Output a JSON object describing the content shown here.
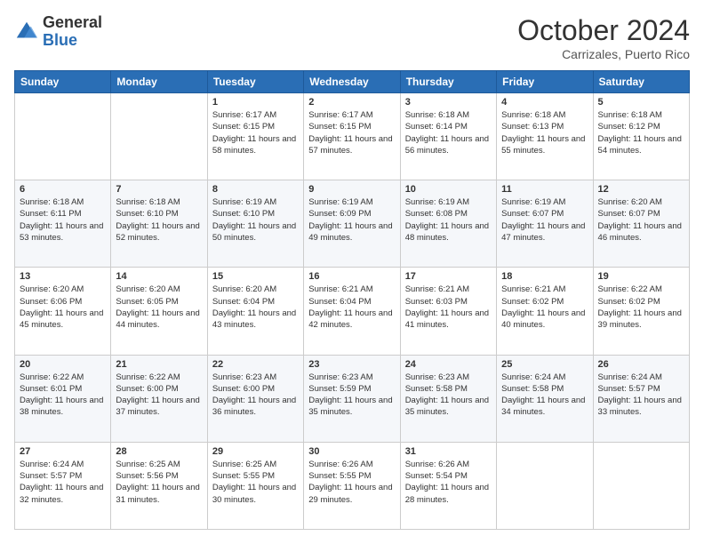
{
  "logo": {
    "general": "General",
    "blue": "Blue"
  },
  "header": {
    "title": "October 2024",
    "subtitle": "Carrizales, Puerto Rico"
  },
  "days_of_week": [
    "Sunday",
    "Monday",
    "Tuesday",
    "Wednesday",
    "Thursday",
    "Friday",
    "Saturday"
  ],
  "weeks": [
    [
      {
        "day": "",
        "sunrise": "",
        "sunset": "",
        "daylight": ""
      },
      {
        "day": "",
        "sunrise": "",
        "sunset": "",
        "daylight": ""
      },
      {
        "day": "1",
        "sunrise": "Sunrise: 6:17 AM",
        "sunset": "Sunset: 6:15 PM",
        "daylight": "Daylight: 11 hours and 58 minutes."
      },
      {
        "day": "2",
        "sunrise": "Sunrise: 6:17 AM",
        "sunset": "Sunset: 6:15 PM",
        "daylight": "Daylight: 11 hours and 57 minutes."
      },
      {
        "day": "3",
        "sunrise": "Sunrise: 6:18 AM",
        "sunset": "Sunset: 6:14 PM",
        "daylight": "Daylight: 11 hours and 56 minutes."
      },
      {
        "day": "4",
        "sunrise": "Sunrise: 6:18 AM",
        "sunset": "Sunset: 6:13 PM",
        "daylight": "Daylight: 11 hours and 55 minutes."
      },
      {
        "day": "5",
        "sunrise": "Sunrise: 6:18 AM",
        "sunset": "Sunset: 6:12 PM",
        "daylight": "Daylight: 11 hours and 54 minutes."
      }
    ],
    [
      {
        "day": "6",
        "sunrise": "Sunrise: 6:18 AM",
        "sunset": "Sunset: 6:11 PM",
        "daylight": "Daylight: 11 hours and 53 minutes."
      },
      {
        "day": "7",
        "sunrise": "Sunrise: 6:18 AM",
        "sunset": "Sunset: 6:10 PM",
        "daylight": "Daylight: 11 hours and 52 minutes."
      },
      {
        "day": "8",
        "sunrise": "Sunrise: 6:19 AM",
        "sunset": "Sunset: 6:10 PM",
        "daylight": "Daylight: 11 hours and 50 minutes."
      },
      {
        "day": "9",
        "sunrise": "Sunrise: 6:19 AM",
        "sunset": "Sunset: 6:09 PM",
        "daylight": "Daylight: 11 hours and 49 minutes."
      },
      {
        "day": "10",
        "sunrise": "Sunrise: 6:19 AM",
        "sunset": "Sunset: 6:08 PM",
        "daylight": "Daylight: 11 hours and 48 minutes."
      },
      {
        "day": "11",
        "sunrise": "Sunrise: 6:19 AM",
        "sunset": "Sunset: 6:07 PM",
        "daylight": "Daylight: 11 hours and 47 minutes."
      },
      {
        "day": "12",
        "sunrise": "Sunrise: 6:20 AM",
        "sunset": "Sunset: 6:07 PM",
        "daylight": "Daylight: 11 hours and 46 minutes."
      }
    ],
    [
      {
        "day": "13",
        "sunrise": "Sunrise: 6:20 AM",
        "sunset": "Sunset: 6:06 PM",
        "daylight": "Daylight: 11 hours and 45 minutes."
      },
      {
        "day": "14",
        "sunrise": "Sunrise: 6:20 AM",
        "sunset": "Sunset: 6:05 PM",
        "daylight": "Daylight: 11 hours and 44 minutes."
      },
      {
        "day": "15",
        "sunrise": "Sunrise: 6:20 AM",
        "sunset": "Sunset: 6:04 PM",
        "daylight": "Daylight: 11 hours and 43 minutes."
      },
      {
        "day": "16",
        "sunrise": "Sunrise: 6:21 AM",
        "sunset": "Sunset: 6:04 PM",
        "daylight": "Daylight: 11 hours and 42 minutes."
      },
      {
        "day": "17",
        "sunrise": "Sunrise: 6:21 AM",
        "sunset": "Sunset: 6:03 PM",
        "daylight": "Daylight: 11 hours and 41 minutes."
      },
      {
        "day": "18",
        "sunrise": "Sunrise: 6:21 AM",
        "sunset": "Sunset: 6:02 PM",
        "daylight": "Daylight: 11 hours and 40 minutes."
      },
      {
        "day": "19",
        "sunrise": "Sunrise: 6:22 AM",
        "sunset": "Sunset: 6:02 PM",
        "daylight": "Daylight: 11 hours and 39 minutes."
      }
    ],
    [
      {
        "day": "20",
        "sunrise": "Sunrise: 6:22 AM",
        "sunset": "Sunset: 6:01 PM",
        "daylight": "Daylight: 11 hours and 38 minutes."
      },
      {
        "day": "21",
        "sunrise": "Sunrise: 6:22 AM",
        "sunset": "Sunset: 6:00 PM",
        "daylight": "Daylight: 11 hours and 37 minutes."
      },
      {
        "day": "22",
        "sunrise": "Sunrise: 6:23 AM",
        "sunset": "Sunset: 6:00 PM",
        "daylight": "Daylight: 11 hours and 36 minutes."
      },
      {
        "day": "23",
        "sunrise": "Sunrise: 6:23 AM",
        "sunset": "Sunset: 5:59 PM",
        "daylight": "Daylight: 11 hours and 35 minutes."
      },
      {
        "day": "24",
        "sunrise": "Sunrise: 6:23 AM",
        "sunset": "Sunset: 5:58 PM",
        "daylight": "Daylight: 11 hours and 35 minutes."
      },
      {
        "day": "25",
        "sunrise": "Sunrise: 6:24 AM",
        "sunset": "Sunset: 5:58 PM",
        "daylight": "Daylight: 11 hours and 34 minutes."
      },
      {
        "day": "26",
        "sunrise": "Sunrise: 6:24 AM",
        "sunset": "Sunset: 5:57 PM",
        "daylight": "Daylight: 11 hours and 33 minutes."
      }
    ],
    [
      {
        "day": "27",
        "sunrise": "Sunrise: 6:24 AM",
        "sunset": "Sunset: 5:57 PM",
        "daylight": "Daylight: 11 hours and 32 minutes."
      },
      {
        "day": "28",
        "sunrise": "Sunrise: 6:25 AM",
        "sunset": "Sunset: 5:56 PM",
        "daylight": "Daylight: 11 hours and 31 minutes."
      },
      {
        "day": "29",
        "sunrise": "Sunrise: 6:25 AM",
        "sunset": "Sunset: 5:55 PM",
        "daylight": "Daylight: 11 hours and 30 minutes."
      },
      {
        "day": "30",
        "sunrise": "Sunrise: 6:26 AM",
        "sunset": "Sunset: 5:55 PM",
        "daylight": "Daylight: 11 hours and 29 minutes."
      },
      {
        "day": "31",
        "sunrise": "Sunrise: 6:26 AM",
        "sunset": "Sunset: 5:54 PM",
        "daylight": "Daylight: 11 hours and 28 minutes."
      },
      {
        "day": "",
        "sunrise": "",
        "sunset": "",
        "daylight": ""
      },
      {
        "day": "",
        "sunrise": "",
        "sunset": "",
        "daylight": ""
      }
    ]
  ]
}
